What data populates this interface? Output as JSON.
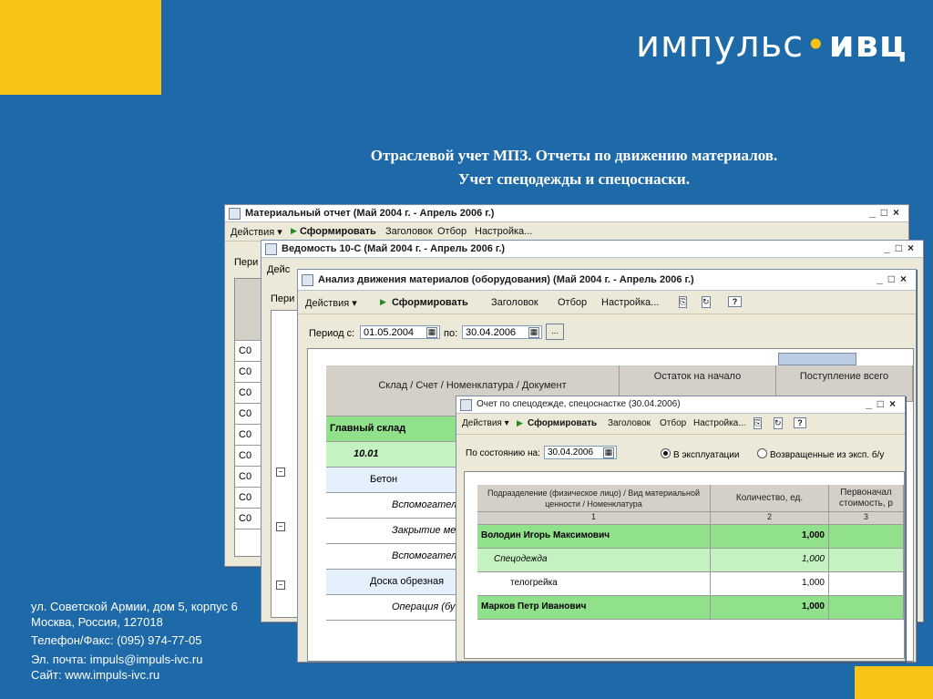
{
  "logo": {
    "left": "импульс",
    "dot": "•",
    "right": "ивц"
  },
  "title": {
    "line1": "Отраслевой учет МПЗ. Отчеты по движению материалов.",
    "line2": "Учет спецодежды и спецоснаски."
  },
  "contact": {
    "address1": "ул. Советской Армии, дом 5, корпус 6",
    "address2": "Москва, Россия, 127018",
    "phone": "Телефон/Факс: (095) 974-77-05",
    "email": "Эл. почта: impuls@impuls-ivc.ru",
    "site": "Сайт: www.impuls-ivc.ru"
  },
  "window_buttons": "_□×",
  "toolbar": {
    "actions": "Действия ▾",
    "form": "Сформировать",
    "header": "Заголовок",
    "filter": "Отбор",
    "settings": "Настройка...",
    "help": "?"
  },
  "w1": {
    "title": "Материальный отчет (Май 2004 г. - Апрель 2006 г.)",
    "period_stub": "Пери",
    "codes": [
      "С0",
      "С0",
      "С0",
      "С0",
      "С0",
      "С0",
      "С0",
      "С0",
      "С0"
    ]
  },
  "w2": {
    "title": "Ведомость 10-С  (Май 2004 г. - Апрель 2006 г.)",
    "actions_stub": "Дейс",
    "period_stub": "Пери"
  },
  "w3": {
    "title": "Анализ движения материалов (оборудования) (Май 2004 г. - Апрель 2006 г.)",
    "period_label": "Период с:",
    "date_from": "01.05.2004",
    "to_label": "по:",
    "date_to": "30.04.2006",
    "more": "...",
    "columns": [
      "Склад / Счет / Номенклатура / Документ",
      "Остаток на начало",
      "Поступление всего"
    ],
    "rows": [
      "Главный склад",
      "10.01",
      "Бетон",
      "Вспомогатель",
      "Закрытие мес",
      "Вспомогатель",
      "Доска обрезная",
      "Операция (бу"
    ]
  },
  "w4": {
    "title": "Очет по спецодежде, спецоснастке (30.04.2006)",
    "state_label": "По состоянию на:",
    "state_date": "30.04.2006",
    "radio1": "В эксплуатации",
    "radio2": "Возвращенные из эксп. б/у",
    "columns": [
      "Подразделение (физическое лицо) / Вид материальной ценности / Номенклатура",
      "Количество, ед.",
      "Первоначал стоимость, р"
    ],
    "col_nums": [
      "1",
      "2",
      "3"
    ],
    "rows": [
      {
        "name": "Володин Игорь Максимович",
        "qty": "1,000"
      },
      {
        "name": "Спецодежда",
        "qty": "1,000"
      },
      {
        "name": "телогрейка",
        "qty": "1,000"
      },
      {
        "name": "Марков Петр Иванович",
        "qty": "1,000"
      }
    ]
  }
}
